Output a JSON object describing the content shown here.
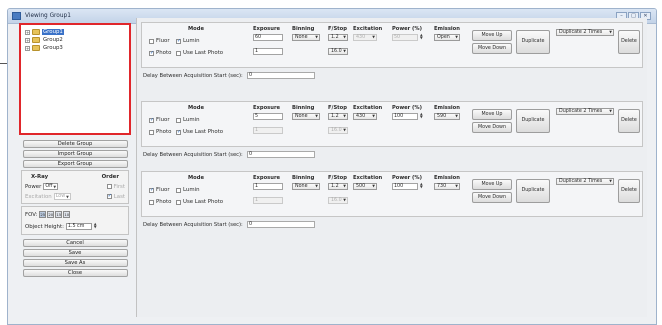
{
  "window": {
    "title": "Viewing Group1",
    "buttons": [
      "–",
      "□",
      "✕"
    ]
  },
  "tree": {
    "items": [
      "Group1",
      "Group2",
      "Group3"
    ],
    "selected": 0
  },
  "left_buttons": {
    "delete_group": "Delete Group",
    "import_group": "Import Group",
    "export_group": "Export Group"
  },
  "xray": {
    "heading": "X-Ray",
    "order_heading": "Order",
    "power_label": "Power",
    "power_value": "Off",
    "first_label": "First",
    "excitation_label": "Excitation",
    "excitation_value": "Low",
    "last_label": "Last"
  },
  "fov": {
    "label": "FOV:",
    "options": [
      "25",
      "20",
      "15",
      "10"
    ]
  },
  "object_height": {
    "label": "Object Height:",
    "value": "1.5 cm"
  },
  "bottom_buttons": {
    "cancel": "Cancel",
    "save": "Save",
    "save_as": "Save As",
    "close": "Close"
  },
  "headers": {
    "mode": "Mode",
    "exposure": "Exposure",
    "binning": "Binning",
    "fstop": "F/Stop",
    "excitation": "Excitation",
    "power": "Power (%)",
    "emission": "Emission"
  },
  "mode_labels": {
    "fluor": "Fluor",
    "lumin": "Lumin",
    "photo": "Photo",
    "use_last_photo": "Use Last Photo"
  },
  "action_labels": {
    "move_up": "Move Up",
    "move_down": "Move Down",
    "duplicate": "Duplicate",
    "delete": "Delete"
  },
  "delay_label": "Delay Between Acquisition Start (sec):",
  "groups": [
    {
      "exposure": "60",
      "exposure2": "1",
      "binning": "None",
      "fstop": "1.2",
      "fstop2": "16.0",
      "excitation": "430",
      "power": "50",
      "emission": "Open",
      "duplicate_times": "Duplicate 2 Times",
      "delay": "0"
    },
    {
      "exposure": "5",
      "exposure2": "1",
      "binning": "None",
      "fstop": "1.2",
      "fstop2": "16.0",
      "excitation": "430",
      "power": "100",
      "emission": "590",
      "duplicate_times": "Duplicate 2 Times",
      "delay": "0"
    },
    {
      "exposure": "1",
      "exposure2": "1",
      "binning": "None",
      "fstop": "1.2",
      "fstop2": "16.0",
      "excitation": "500",
      "power": "100",
      "emission": "730",
      "duplicate_times": "Duplicate 2 Times",
      "delay": "0"
    }
  ]
}
